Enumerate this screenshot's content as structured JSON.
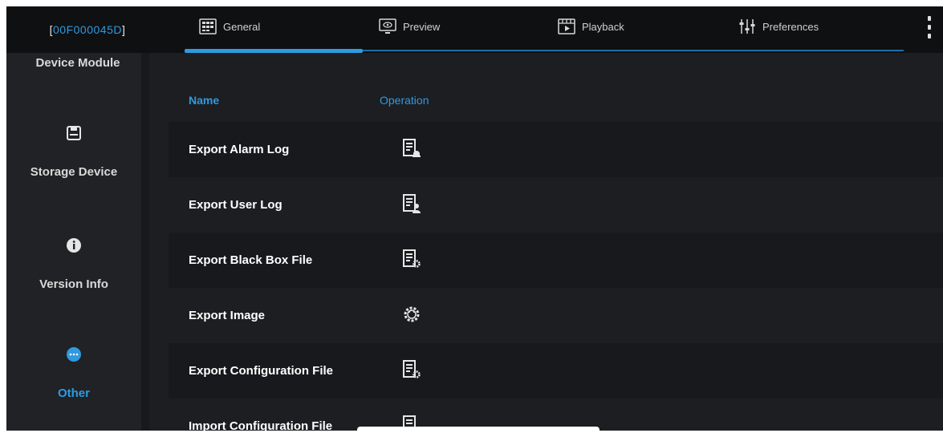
{
  "device": {
    "id": "00F000045D",
    "bracket_open": "[ ",
    "bracket_close": " ]"
  },
  "sidebar": {
    "title": "Device Module",
    "items": [
      {
        "label": "Storage Device",
        "icon": "floppy-disk-icon"
      },
      {
        "label": "Version Info",
        "icon": "info-icon"
      },
      {
        "label": "Other",
        "icon": "chat-bubble-icon",
        "active": true
      }
    ]
  },
  "tabs": [
    {
      "label": "General",
      "icon": "general-grid-icon",
      "active": true
    },
    {
      "label": "Preview",
      "icon": "preview-monitor-icon"
    },
    {
      "label": "Playback",
      "icon": "playback-film-icon"
    },
    {
      "label": "Preferences",
      "icon": "preferences-sliders-icon"
    }
  ],
  "table": {
    "headers": {
      "name": "Name",
      "operation": "Operation"
    },
    "rows": [
      {
        "name": "Export Alarm Log",
        "icon": "export-alarm-log-icon"
      },
      {
        "name": "Export User Log",
        "icon": "export-user-log-icon"
      },
      {
        "name": "Export Black Box File",
        "icon": "export-file-gear-icon"
      },
      {
        "name": "Export Image",
        "icon": "export-image-gear-icon"
      },
      {
        "name": "Export Configuration File",
        "icon": "export-config-gear-icon"
      },
      {
        "name": "Import Configuration File",
        "icon": "import-config-icon"
      }
    ]
  },
  "colors": {
    "accent": "#2f9ae0",
    "background": "#1c1e22",
    "row_dark": "#17191c",
    "nav": "#0f1012"
  }
}
